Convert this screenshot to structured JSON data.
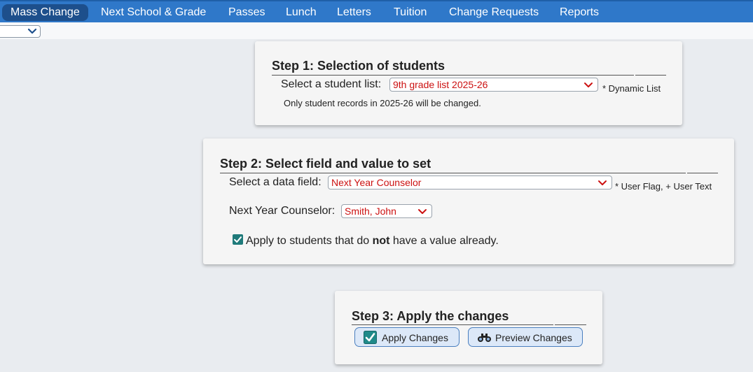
{
  "nav": {
    "items": [
      "Mass Change",
      "Next School & Grade",
      "Passes",
      "Lunch",
      "Letters",
      "Tuition",
      "Change Requests",
      "Reports"
    ],
    "active": "Mass Change"
  },
  "step1": {
    "title": "Step 1: Selection of students",
    "list_label": "Select a student list:",
    "list_value": "9th grade list 2025-26",
    "list_note": "* Dynamic List",
    "info": "Only student records in 2025-26 will be changed."
  },
  "step2": {
    "title": "Step 2: Select field and value to set",
    "field_label": "Select a data field:",
    "field_value": "Next Year Counselor",
    "field_note": "* User Flag, + User Text",
    "value_label": "Next Year Counselor:",
    "value_value": "Smith, John",
    "apply_prefix": "Apply to students that do ",
    "apply_bold": "not",
    "apply_suffix": " have a value already.",
    "apply_checked": true
  },
  "step3": {
    "title": "Step 3: Apply the changes",
    "apply_button": "Apply Changes",
    "preview_button": "Preview Changes"
  },
  "colors": {
    "nav_bg": "#2f78c9",
    "nav_active": "#1d4f8c",
    "select_text": "#cc1111",
    "checkbox": "#1f7a7a",
    "button_bg": "#dce8f8"
  },
  "icons": {
    "checkmark": "check-icon",
    "binoculars": "binoculars-icon",
    "chevron": "chevron-down-icon"
  }
}
